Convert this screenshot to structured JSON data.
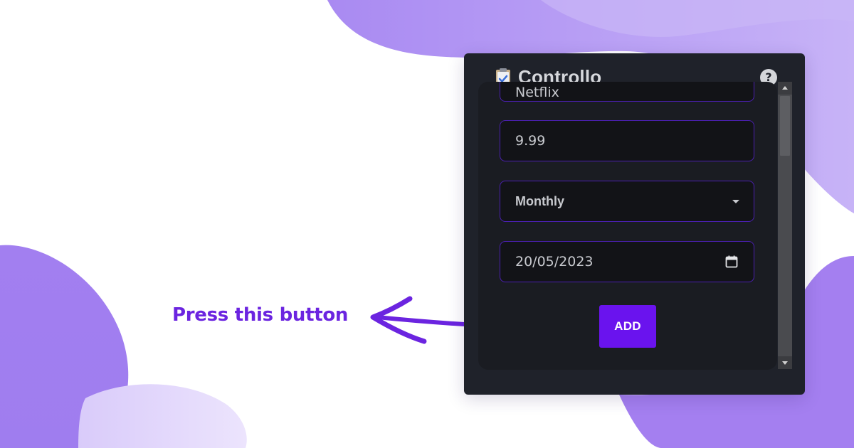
{
  "callout": {
    "text": "Press this button"
  },
  "app": {
    "title": "Controllo",
    "icon": "clipboard-check-icon",
    "help_icon": "question-circle-icon",
    "help_label": "?"
  },
  "form": {
    "name_value": "Netflix",
    "price_value": "9.99",
    "period_value": "Monthly",
    "date_value": "20/05/2023",
    "add_label": "ADD"
  },
  "colors": {
    "accent": "#6a13ee",
    "callout_text": "#6b24e0",
    "field_border": "#4a1fb0",
    "popup_bg": "#1f222a",
    "blob_purple": "#a78bf0"
  }
}
